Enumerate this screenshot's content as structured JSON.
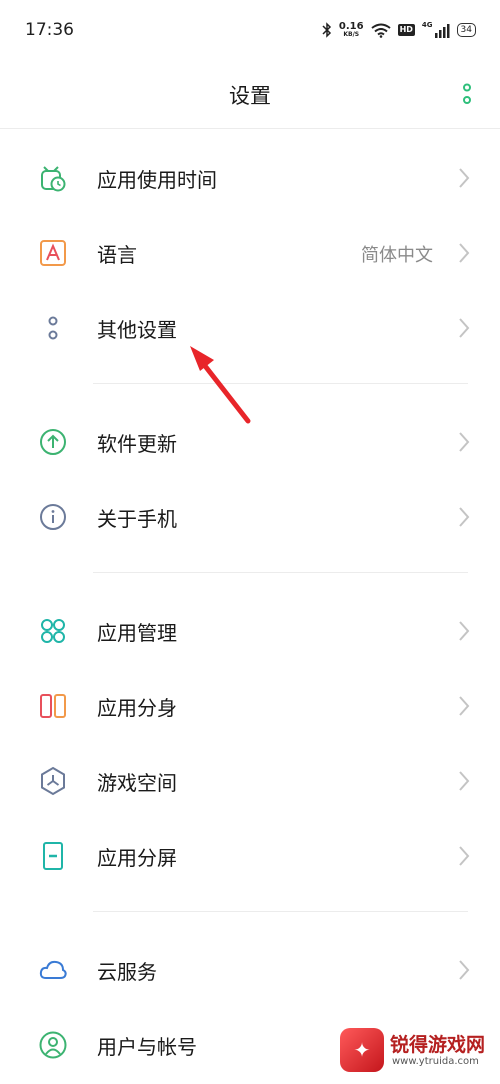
{
  "status_bar": {
    "time": "17:36",
    "net_speed_value": "0.16",
    "net_speed_unit": "KB/S",
    "hd_label": "HD",
    "signal_label": "4G",
    "battery": "34"
  },
  "header": {
    "title": "设置",
    "accent_color": "#2ebf7b"
  },
  "sections": [
    {
      "items": [
        {
          "label": "应用使用时间",
          "icon": "app-usage-time-icon"
        },
        {
          "label": "语言",
          "value": "简体中文",
          "icon": "language-icon"
        },
        {
          "label": "其他设置",
          "icon": "other-settings-icon"
        }
      ]
    },
    {
      "items": [
        {
          "label": "软件更新",
          "icon": "software-update-icon"
        },
        {
          "label": "关于手机",
          "icon": "about-phone-icon"
        }
      ]
    },
    {
      "items": [
        {
          "label": "应用管理",
          "icon": "app-management-icon"
        },
        {
          "label": "应用分身",
          "icon": "app-clone-icon"
        },
        {
          "label": "游戏空间",
          "icon": "game-space-icon"
        },
        {
          "label": "应用分屏",
          "icon": "split-screen-icon"
        }
      ]
    },
    {
      "items": [
        {
          "label": "云服务",
          "icon": "cloud-service-icon"
        },
        {
          "label": "用户与帐号",
          "icon": "user-account-icon"
        }
      ]
    }
  ],
  "annotation": {
    "color": "#e8252a"
  },
  "watermark": {
    "badge": "✦",
    "name": "锐得游戏网",
    "url": "www.ytruida.com"
  }
}
